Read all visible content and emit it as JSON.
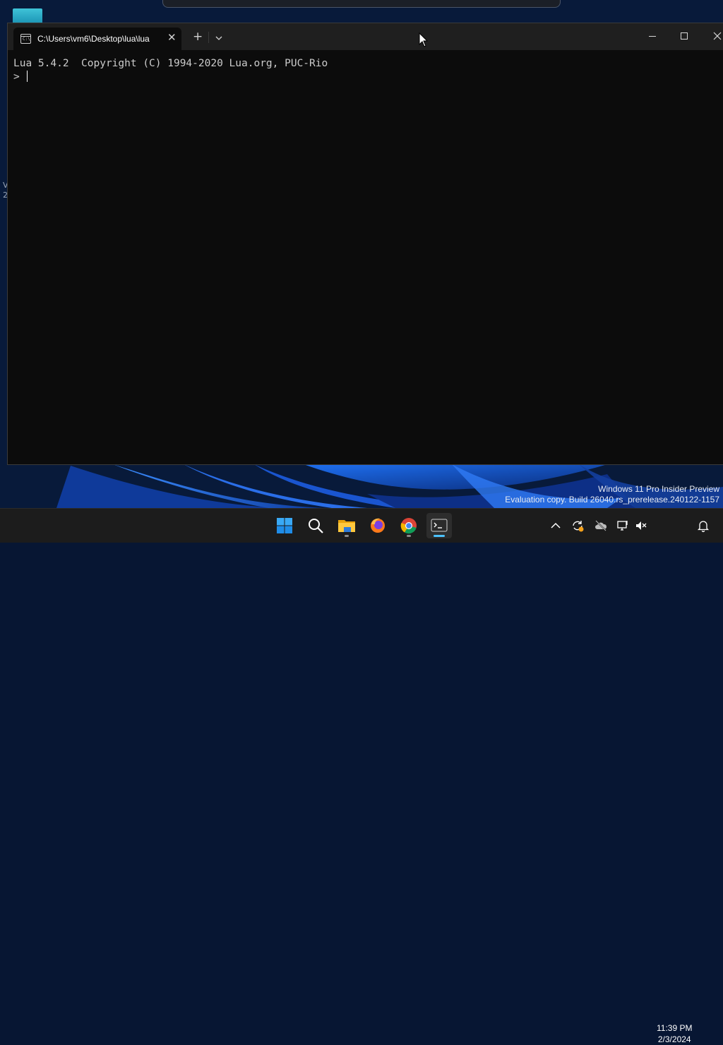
{
  "desktop": {
    "left_labels": [
      "V",
      "2"
    ],
    "watermark": {
      "line1": "Windows 11 Pro Insider Preview",
      "line2": "Evaluation copy. Build 26040.rs_prerelease.240122-1157"
    }
  },
  "terminal": {
    "tab_title": "C:\\Users\\vm6\\Desktop\\lua\\lua",
    "tab_icon_text": "C:\\",
    "close_tab_glyph": "✕",
    "new_tab_glyph": "+",
    "lines": [
      "Lua 5.4.2  Copyright (C) 1994-2020 Lua.org, PUC-Rio",
      "> "
    ]
  },
  "taskbar": {
    "apps": [
      {
        "name": "start",
        "icon": "windows-logo-icon"
      },
      {
        "name": "search",
        "icon": "search-icon"
      },
      {
        "name": "file-explorer",
        "icon": "folder-icon",
        "running": true
      },
      {
        "name": "firefox",
        "icon": "firefox-icon"
      },
      {
        "name": "chrome",
        "icon": "chrome-icon",
        "running": true
      },
      {
        "name": "terminal",
        "icon": "terminal-icon",
        "active": true
      }
    ],
    "clock": {
      "time": "11:39 PM",
      "date": "2/3/2024"
    }
  },
  "colors": {
    "accent": "#4cc2ff",
    "terminal_bg": "#0c0c0c",
    "titlebar_bg": "#1f1f1f",
    "taskbar_bg": "#1c1c1c"
  }
}
